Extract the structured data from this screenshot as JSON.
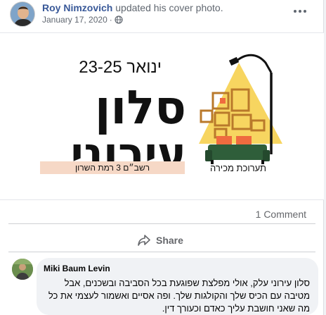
{
  "post": {
    "author_name": "Roy Nimzovich",
    "action_text": "updated his cover photo.",
    "date": "January 17, 2020",
    "separator": "·",
    "privacy_icon": "globe-icon",
    "more_icon": "more-options-icon"
  },
  "cover": {
    "dates": "23-25 ינואר",
    "title_line1": "סלון",
    "title_line2": "עירוני",
    "venue": "רשב״ם 3 רמת השרון",
    "exhibition_label": "תערוכת מכירה",
    "colors": {
      "triangle": "#f7d560",
      "sofa": "#2f5e3a",
      "rug": "#ef6b3f",
      "venue_band": "#f6d8c6",
      "frames": "#b9792b",
      "text": "#111111"
    }
  },
  "stats": {
    "comments": "1 Comment"
  },
  "actions": {
    "share_label": "Share",
    "share_icon": "share-arrow-icon"
  },
  "comment": {
    "author": "Miki Baum Levin",
    "text": "סלון עירוני עלק, אולי מפלצת שפוגעת בכל הסביבה ובשכנים, אבל מטיבה עם הכיס שלך והקולגות שלך. ופה אסיים ואשמור לעצמי את כל מה שאני חושבת עליך כאדם וכעורך דין."
  }
}
